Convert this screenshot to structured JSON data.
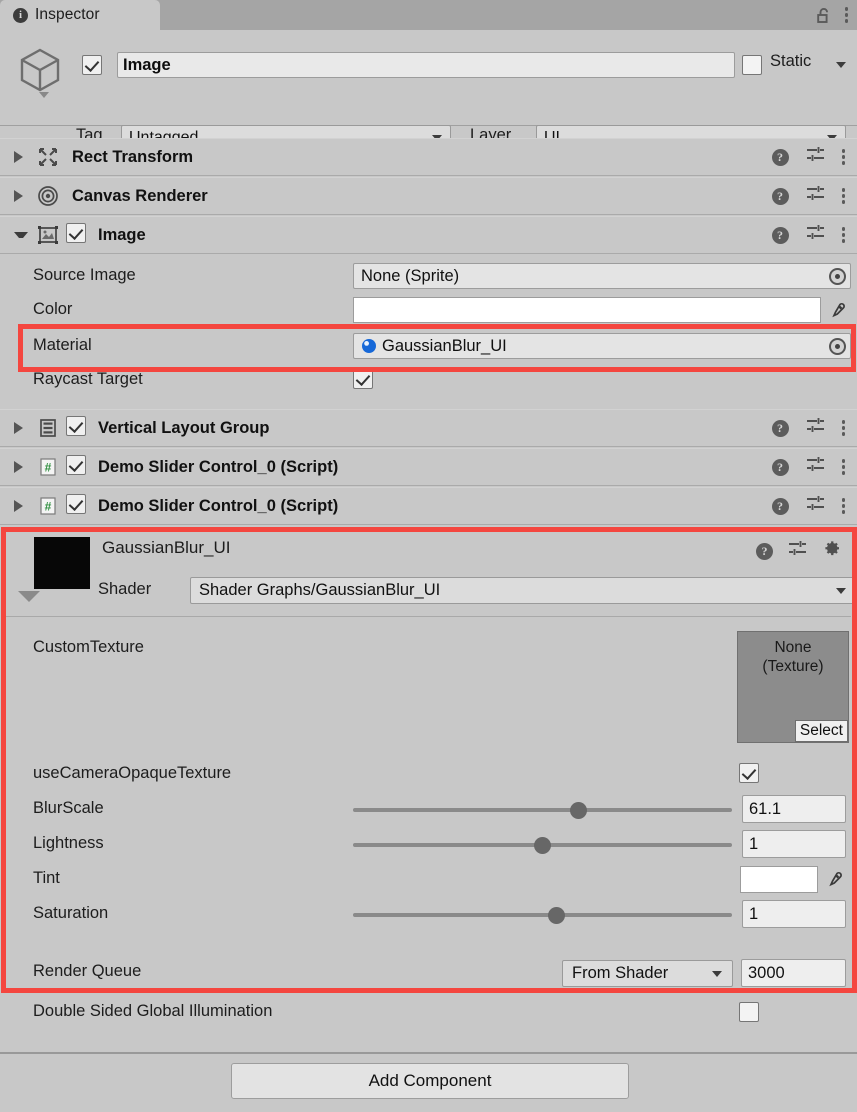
{
  "window": {
    "tab_label": "Inspector",
    "tab_icon": "info-icon",
    "lock_icon": "unlocked-padlock-icon",
    "menu_icon": "kebab-menu-icon"
  },
  "gameobject": {
    "enabled_checkbox": true,
    "name": "Image",
    "static_label": "Static",
    "static_checked": false,
    "tag_label": "Tag",
    "tag_value": "Untagged",
    "layer_label": "Layer",
    "layer_value": "UI"
  },
  "components": [
    {
      "title": "Rect Transform",
      "icon": "rect-transform-icon",
      "expanded": false,
      "has_toggle": false,
      "toggle": false
    },
    {
      "title": "Canvas Renderer",
      "icon": "canvas-renderer-icon",
      "expanded": false,
      "has_toggle": false,
      "toggle": false
    },
    {
      "title": "Image",
      "icon": "image-sprite-icon",
      "expanded": true,
      "has_toggle": true,
      "toggle": true
    },
    {
      "title": "Vertical Layout Group",
      "icon": "vertical-layout-icon",
      "expanded": false,
      "has_toggle": true,
      "toggle": true
    },
    {
      "title": "Demo Slider Control_0 (Script)",
      "icon": "csharp-script-icon",
      "expanded": false,
      "has_toggle": true,
      "toggle": true
    },
    {
      "title": "Demo Slider Control_0 (Script)",
      "icon": "csharp-script-icon",
      "expanded": false,
      "has_toggle": true,
      "toggle": true
    }
  ],
  "image_component": {
    "source_image_label": "Source Image",
    "source_image_value": "None (Sprite)",
    "color_label": "Color",
    "color_value": "#FFFFFF",
    "material_label": "Material",
    "material_value": "GaussianBlur_UI",
    "raycast_label": "Raycast Target",
    "raycast_checked": true
  },
  "material_inspector": {
    "name": "GaussianBlur_UI",
    "preview_color": "#070707",
    "shader_label": "Shader",
    "shader_value": "Shader Graphs/GaussianBlur_UI",
    "properties": {
      "custom_texture_label": "CustomTexture",
      "custom_texture_value": "None",
      "custom_texture_type": "(Texture)",
      "select_button": "Select",
      "use_camera_opaque_label": "useCameraOpaqueTexture",
      "use_camera_opaque_checked": true,
      "blur_scale_label": "BlurScale",
      "blur_scale_value": "61.1",
      "blur_scale_percent": 60,
      "lightness_label": "Lightness",
      "lightness_value": "1",
      "lightness_percent": 50,
      "tint_label": "Tint",
      "tint_color": "#FFFFFF",
      "saturation_label": "Saturation",
      "saturation_value": "1",
      "saturation_percent": 54
    },
    "render_queue_label": "Render Queue",
    "render_queue_mode": "From Shader",
    "render_queue_value": "3000",
    "double_sided_gi_label": "Double Sided Global Illumination",
    "double_sided_gi_checked": false
  },
  "footer": {
    "add_component_label": "Add Component"
  },
  "highlight_color": "#F4463F"
}
